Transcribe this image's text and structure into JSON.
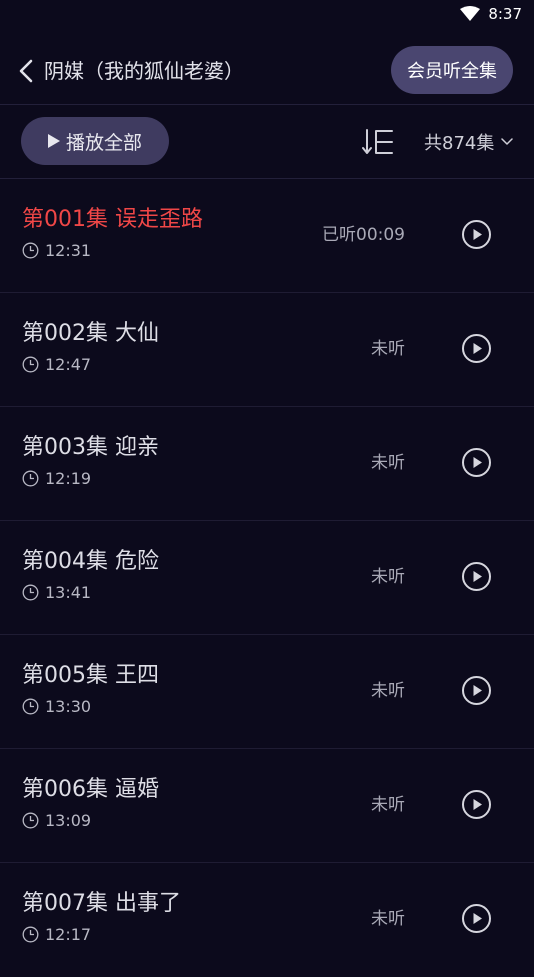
{
  "status_bar": {
    "time": "8:37"
  },
  "header": {
    "title": "阴媒（我的狐仙老婆）",
    "vip_button": "会员听全集"
  },
  "toolbar": {
    "play_all": "播放全部",
    "episode_count": "共874集"
  },
  "colors": {
    "background": "#0c0a1c",
    "active_title": "#f04747",
    "button_bg": "#3f3b60"
  },
  "episodes": [
    {
      "title": "第001集 误走歪路",
      "duration": "12:31",
      "status": "已听00:09",
      "active": true
    },
    {
      "title": "第002集 大仙",
      "duration": "12:47",
      "status": "未听",
      "active": false
    },
    {
      "title": "第003集 迎亲",
      "duration": "12:19",
      "status": "未听",
      "active": false
    },
    {
      "title": "第004集 危险",
      "duration": "13:41",
      "status": "未听",
      "active": false
    },
    {
      "title": "第005集 王四",
      "duration": "13:30",
      "status": "未听",
      "active": false
    },
    {
      "title": "第006集 逼婚",
      "duration": "13:09",
      "status": "未听",
      "active": false
    },
    {
      "title": "第007集 出事了",
      "duration": "12:17",
      "status": "未听",
      "active": false
    }
  ]
}
